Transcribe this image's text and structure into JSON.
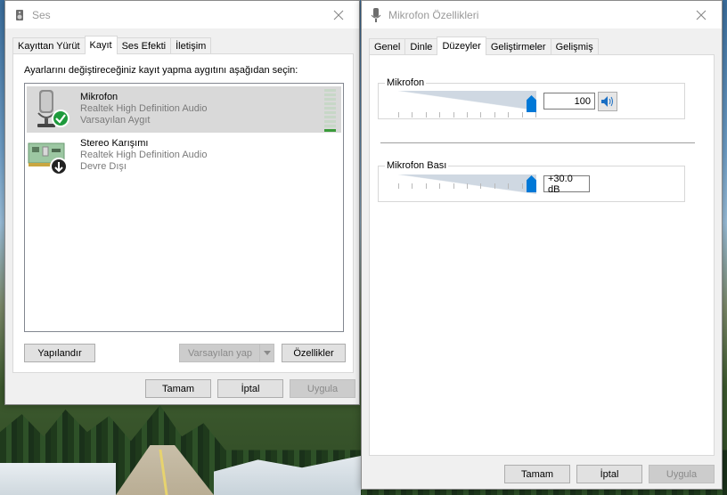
{
  "sound_window": {
    "title": "Ses",
    "tabs": [
      "Kayıttan Yürüt",
      "Kayıt",
      "Ses Efekti",
      "İletişim"
    ],
    "active_tab": "Kayıt",
    "instruction": "Ayarlarını değiştireceğiniz kayıt yapma aygıtını aşağıdan seçin:",
    "devices": [
      {
        "name": "Mikrofon",
        "driver": "Realtek High Definition Audio",
        "status": "Varsayılan Aygıt",
        "selected": true,
        "badge_icon": "check-icon",
        "meter_level": 0.1
      },
      {
        "name": "Stereo Karışımı",
        "driver": "Realtek High Definition Audio",
        "status": "Devre Dışı",
        "selected": false,
        "badge_icon": "down-arrow-icon"
      }
    ],
    "buttons": {
      "configure": "Yapılandır",
      "set_default": "Varsayılan yap",
      "properties": "Özellikler",
      "ok": "Tamam",
      "cancel": "İptal",
      "apply": "Uygula"
    }
  },
  "mic_window": {
    "title": "Mikrofon Özellikleri",
    "tabs": [
      "Genel",
      "Dinle",
      "Düzeyler",
      "Geliştirmeler",
      "Gelişmiş"
    ],
    "active_tab": "Düzeyler",
    "levels": [
      {
        "label": "Mikrofon",
        "value": "100",
        "level": 1.0
      },
      {
        "label": "Mikrofon Bası",
        "value": "+30.0 dB",
        "level": 1.0
      }
    ],
    "buttons": {
      "ok": "Tamam",
      "cancel": "İptal",
      "apply": "Uygula"
    }
  },
  "colors": {
    "accent": "#0078d7",
    "meter_on": "#3a9b3a",
    "selection": "#d9d9d9",
    "check_badge": "#1e9a3c"
  }
}
